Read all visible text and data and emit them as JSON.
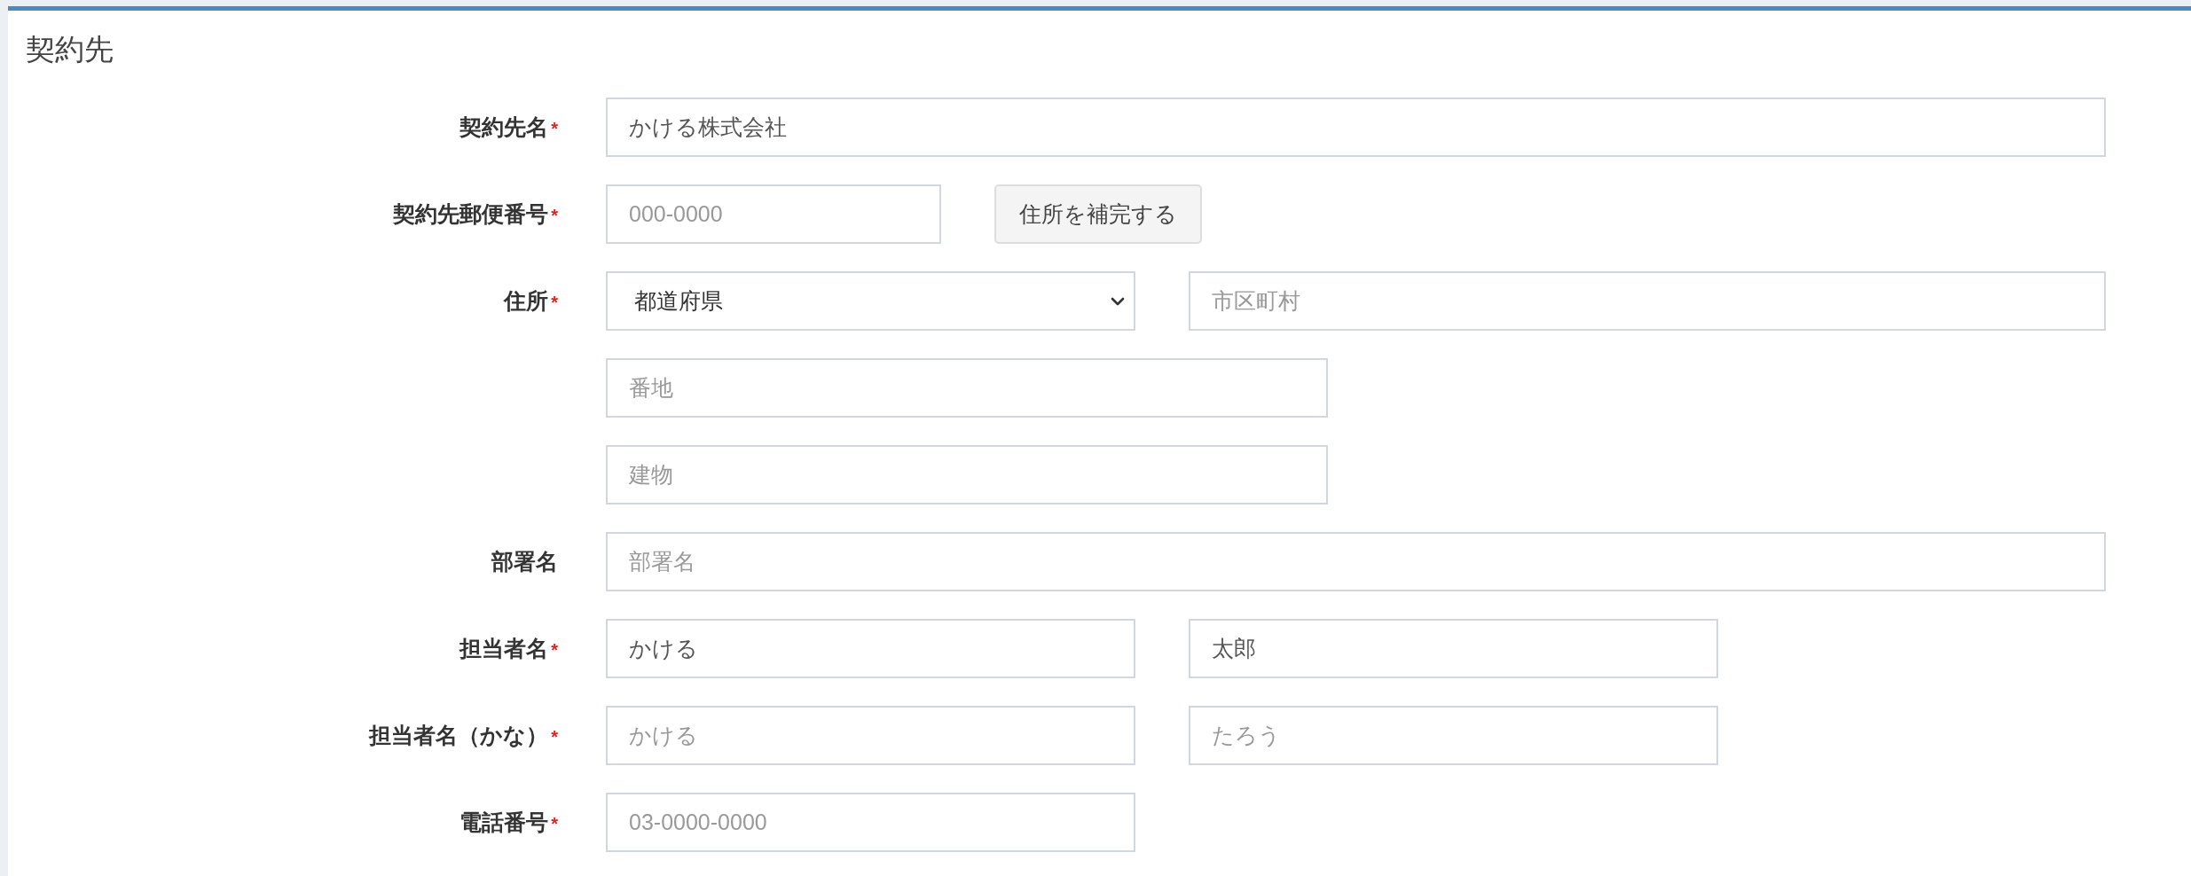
{
  "panel": {
    "title": "契約先"
  },
  "rows": [
    {
      "label": "契約先名",
      "required_mark": "*",
      "fields": [
        {
          "kind": "text",
          "value": "かける株式会社"
        }
      ]
    },
    {
      "label": "契約先郵便番号",
      "required_mark": "*",
      "fields": [
        {
          "kind": "text",
          "placeholder": "000-0000"
        },
        {
          "kind": "button",
          "label": "住所を補完する"
        }
      ]
    },
    {
      "label": "住所",
      "required_mark": "*",
      "fields": [
        {
          "kind": "select",
          "value": "都道府県"
        },
        {
          "kind": "text",
          "placeholder": "市区町村"
        }
      ]
    },
    {
      "fields": [
        {
          "kind": "text",
          "placeholder": "番地"
        }
      ]
    },
    {
      "fields": [
        {
          "kind": "text",
          "placeholder": "建物"
        }
      ]
    },
    {
      "label": "部署名",
      "fields": [
        {
          "kind": "text",
          "placeholder": "部署名"
        }
      ]
    },
    {
      "label": "担当者名",
      "required_mark": "*",
      "fields": [
        {
          "kind": "text",
          "value": "かける"
        },
        {
          "kind": "text",
          "value": "太郎"
        }
      ]
    },
    {
      "label": "担当者名（かな）",
      "required_mark": "*",
      "fields": [
        {
          "kind": "text",
          "placeholder": "かける"
        },
        {
          "kind": "text",
          "placeholder": "たろう"
        }
      ]
    },
    {
      "label": "電話番号",
      "required_mark": "*",
      "fields": [
        {
          "kind": "text",
          "placeholder": "03-0000-0000"
        }
      ]
    }
  ]
}
